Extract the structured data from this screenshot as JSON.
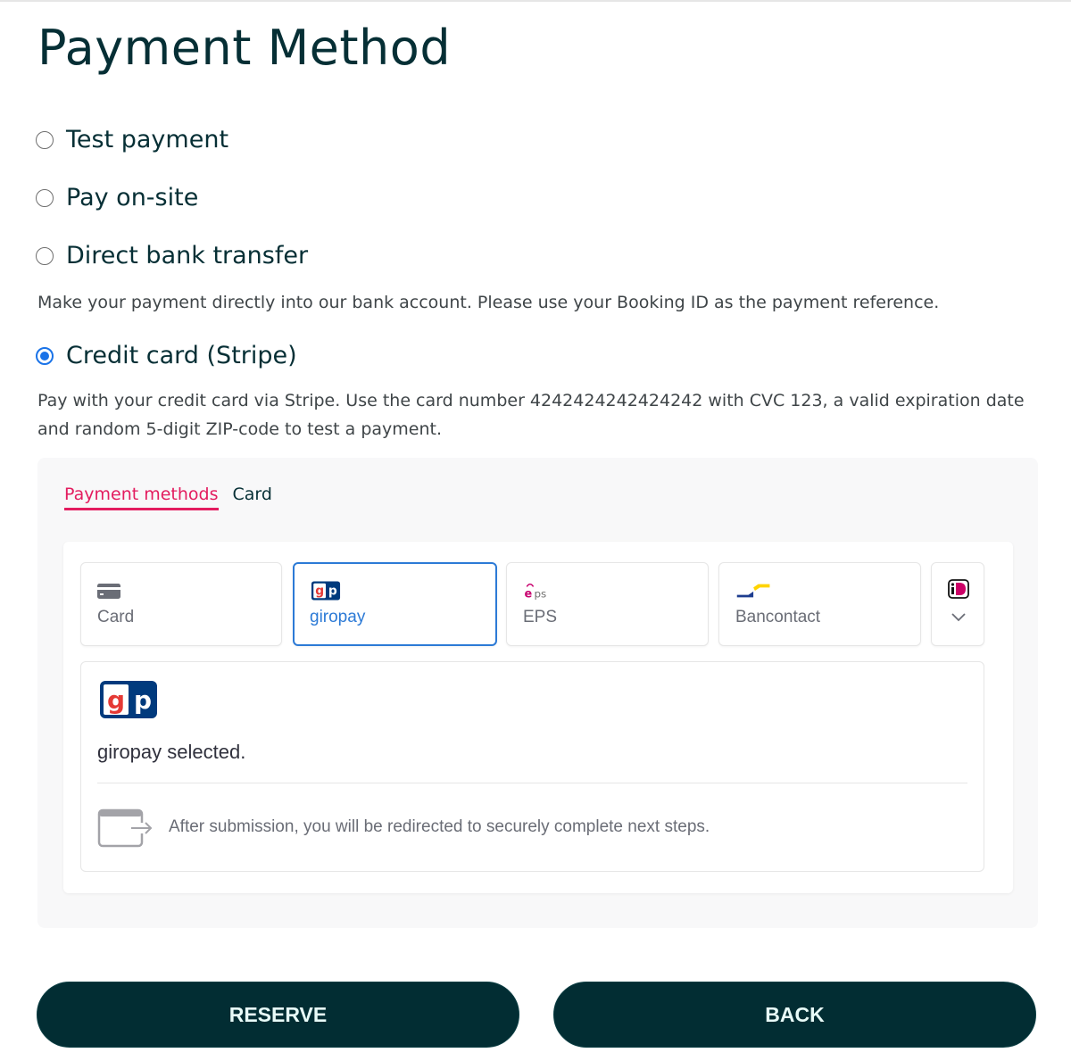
{
  "page": {
    "title": "Payment Method"
  },
  "payment_options": [
    {
      "label": "Test payment",
      "checked": false
    },
    {
      "label": "Pay on-site",
      "checked": false
    },
    {
      "label": "Direct bank transfer",
      "checked": false,
      "description": "Make your payment directly into our bank account. Please use your Booking ID as the payment reference."
    },
    {
      "label": "Credit card (Stripe)",
      "checked": true,
      "description_line1": "Pay with your credit card via Stripe. Use the card number 4242424242424242 with CVC 123, a valid expiration date",
      "description_line2": "and random 5-digit ZIP-code to test a payment."
    }
  ],
  "stripe": {
    "tabs": [
      {
        "label": "Payment methods",
        "active": true
      },
      {
        "label": "Card",
        "active": false
      }
    ],
    "methods": [
      {
        "label": "Card",
        "icon": "credit-card-icon",
        "selected": false
      },
      {
        "label": "giropay",
        "icon": "giropay-logo-icon",
        "selected": true
      },
      {
        "label": "EPS",
        "icon": "eps-logo-icon",
        "selected": false
      },
      {
        "label": "Bancontact",
        "icon": "bancontact-logo-icon",
        "selected": false
      }
    ],
    "more_methods_icon": "ideal-logo-icon",
    "selected_detail": {
      "title": "giropay selected.",
      "redirect_text": "After submission, you will be redirected to securely complete next steps."
    },
    "accent_color": "#e31c5f",
    "selected_color": "#2c7ad6"
  },
  "buttons": {
    "reserve": "RESERVE",
    "back": "BACK"
  }
}
